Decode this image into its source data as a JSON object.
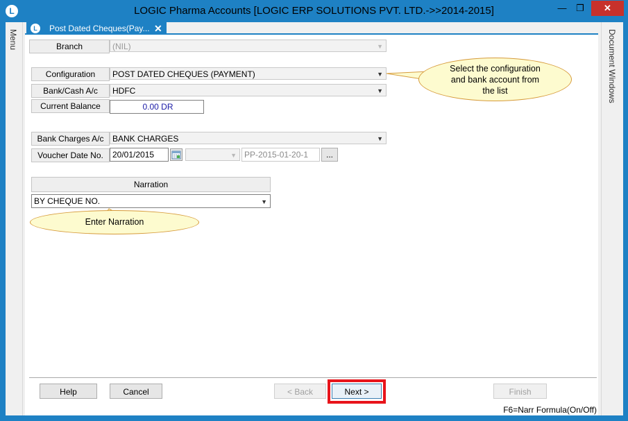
{
  "window": {
    "title": "LOGIC Pharma Accounts  [LOGIC ERP SOLUTIONS PVT. LTD.->>2014-2015]",
    "minimize_glyph": "—",
    "maximize_glyph": "❐",
    "close_glyph": "✕"
  },
  "side": {
    "menu_label": "Menu",
    "document_windows_label": "Document Windows"
  },
  "tab": {
    "title": "Post Dated Cheques(Pay...",
    "close_glyph": "✕"
  },
  "form": {
    "branch": {
      "label": "Branch",
      "value": "(NIL)"
    },
    "configuration": {
      "label": "Configuration",
      "value": "POST DATED CHEQUES (PAYMENT)"
    },
    "bank_cash": {
      "label": "Bank/Cash A/c",
      "value": "HDFC"
    },
    "current_balance": {
      "label": "Current Balance",
      "value": "0.00 DR"
    },
    "bank_charges": {
      "label": "Bank Charges A/c",
      "value": "BANK CHARGES"
    },
    "voucher": {
      "label": "Voucher Date  No.",
      "date": "20/01/2015",
      "number_combo": "",
      "number": "PP-2015-01-20-1",
      "browse_label": "..."
    },
    "narration": {
      "header": "Narration",
      "value": "BY CHEQUE NO."
    }
  },
  "callouts": {
    "config_tip": [
      "Select the configuration",
      "and bank account from",
      "the list"
    ],
    "narration_tip": "Enter Narration"
  },
  "buttons": {
    "help": "Help",
    "cancel": "Cancel",
    "back": "< Back",
    "next": "Next >",
    "finish": "Finish"
  },
  "status": {
    "hint": "F6=Narr Formula(On/Off)"
  },
  "colors": {
    "title_bar": "#1e81c4",
    "highlight": "#e8141b",
    "callout_fill": "#fdfbcf",
    "balance_text": "#1a1aa6"
  },
  "icons": {
    "app": "logic-logo-icon",
    "calendar": "calendar-icon",
    "dropdown": "chevron-down-icon"
  }
}
